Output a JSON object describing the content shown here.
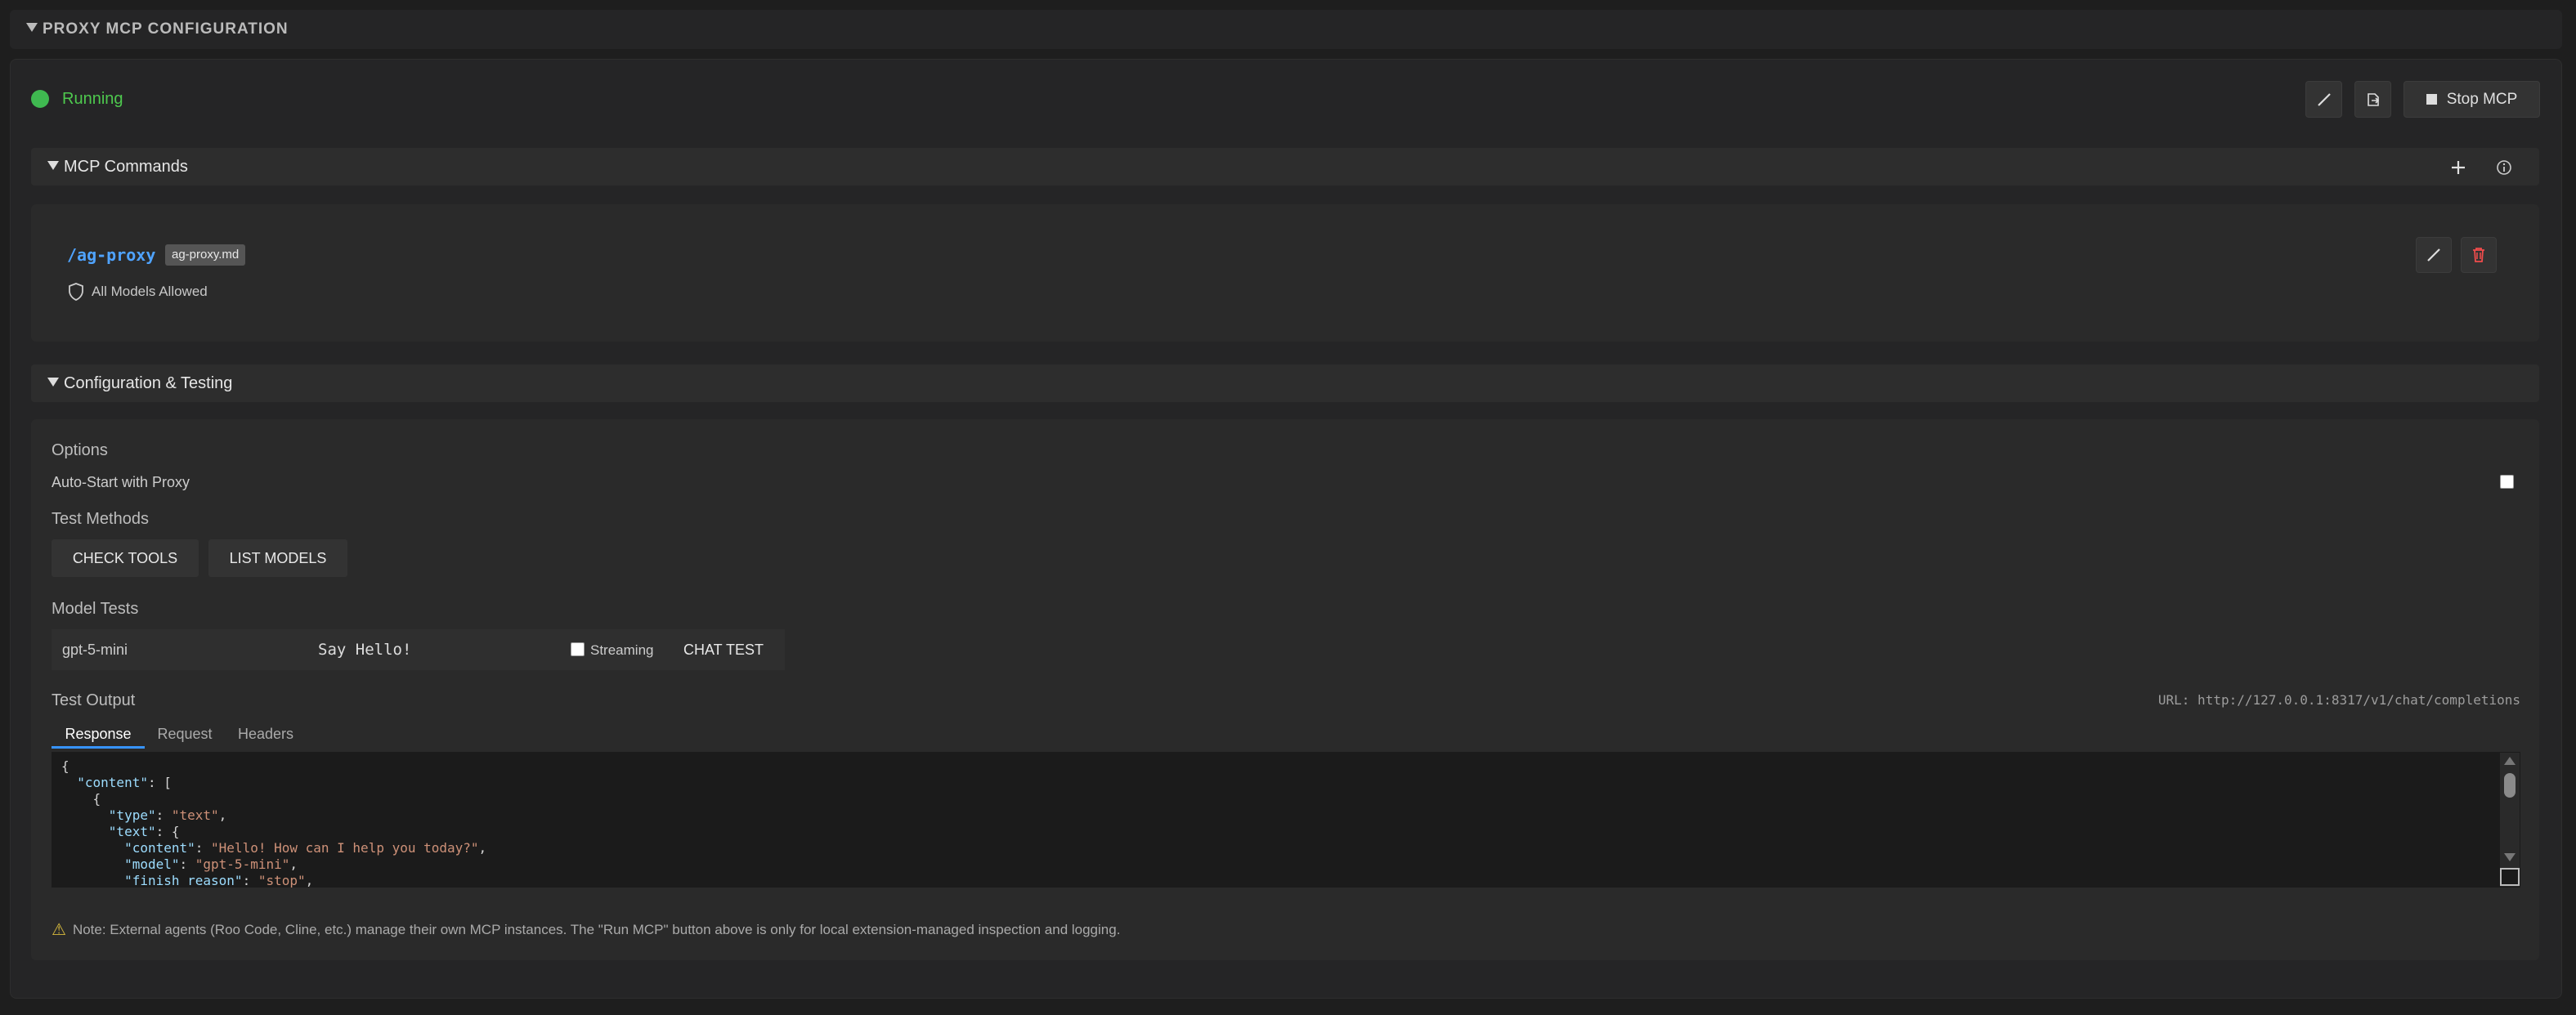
{
  "header": {
    "title": "PROXY MCP CONFIGURATION"
  },
  "status": {
    "text": "Running",
    "color": "#3fb950"
  },
  "toolbar": {
    "stop_label": "Stop MCP",
    "edit_icon": "pencil-icon",
    "export_icon": "export-icon"
  },
  "mcp_commands": {
    "title": "MCP Commands",
    "commands": [
      {
        "name": "/ag-proxy",
        "file": "ag-proxy.md",
        "models": "All Models Allowed"
      }
    ]
  },
  "config": {
    "title": "Configuration & Testing",
    "options_heading": "Options",
    "auto_start_label": "Auto-Start with Proxy",
    "auto_start_checked": false,
    "test_methods_heading": "Test Methods",
    "check_tools_label": "CHECK TOOLS",
    "list_models_label": "LIST MODELS",
    "model_tests_heading": "Model Tests",
    "model_value": "gpt-5-mini",
    "prompt_value": "Say Hello!",
    "streaming_label": "Streaming",
    "streaming_checked": false,
    "chat_test_label": "CHAT TEST",
    "test_output_heading": "Test Output",
    "url_text": "URL: http://127.0.0.1:8317/v1/chat/completions",
    "tabs": [
      {
        "label": "Response",
        "active": true
      },
      {
        "label": "Request",
        "active": false
      },
      {
        "label": "Headers",
        "active": false
      }
    ],
    "output_lines": [
      "{",
      "  \"content\": [",
      "    {",
      "      \"type\": \"text\",",
      "      \"text\": {",
      "        \"content\": \"Hello! How can I help you today?\",",
      "        \"model\": \"gpt-5-mini\",",
      "        \"finish_reason\": \"stop\","
    ],
    "note": "Note: External agents (Roo Code, Cline, etc.) manage their own MCP instances. The \"Run MCP\" button above is only for local extension-managed inspection and logging."
  }
}
